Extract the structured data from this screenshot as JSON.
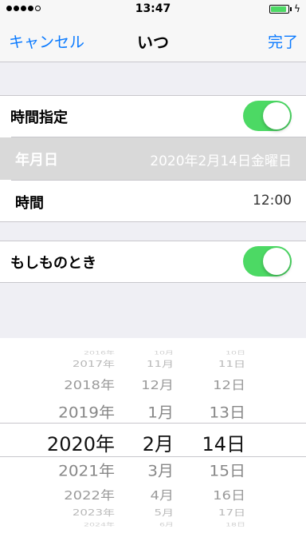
{
  "status_bar": {
    "time": "13:47",
    "signal_bars_filled": 4,
    "signal_bars_total": 5,
    "battery_level": 0.92,
    "charging_symbol": "ϟ"
  },
  "nav": {
    "cancel_label": "キャンセル",
    "title": "いつ",
    "done_label": "完了"
  },
  "settings": {
    "timed_label": "時間指定",
    "timed_on": true,
    "date_label": "年月日",
    "date_value": "2020年2月14日金曜日",
    "time_label": "時間",
    "time_value": "12:00",
    "emergency_label": "もしものとき",
    "emergency_on": true
  },
  "picker": {
    "years": [
      "2016年",
      "2017年",
      "2018年",
      "2019年",
      "2020年",
      "2021年",
      "2022年",
      "2023年",
      "2024年"
    ],
    "months": [
      "10月",
      "11月",
      "12月",
      "1月",
      "2月",
      "3月",
      "4月",
      "5月",
      "6月"
    ],
    "days": [
      "10日",
      "11日",
      "12日",
      "13日",
      "14日",
      "15日",
      "16日",
      "17日",
      "18日"
    ],
    "selected_index": 4
  },
  "colors": {
    "accent_blue": "#0a7aff",
    "toggle_green": "#4cd964",
    "selected_row": "#d9d9d9",
    "background": "#efeff4"
  }
}
